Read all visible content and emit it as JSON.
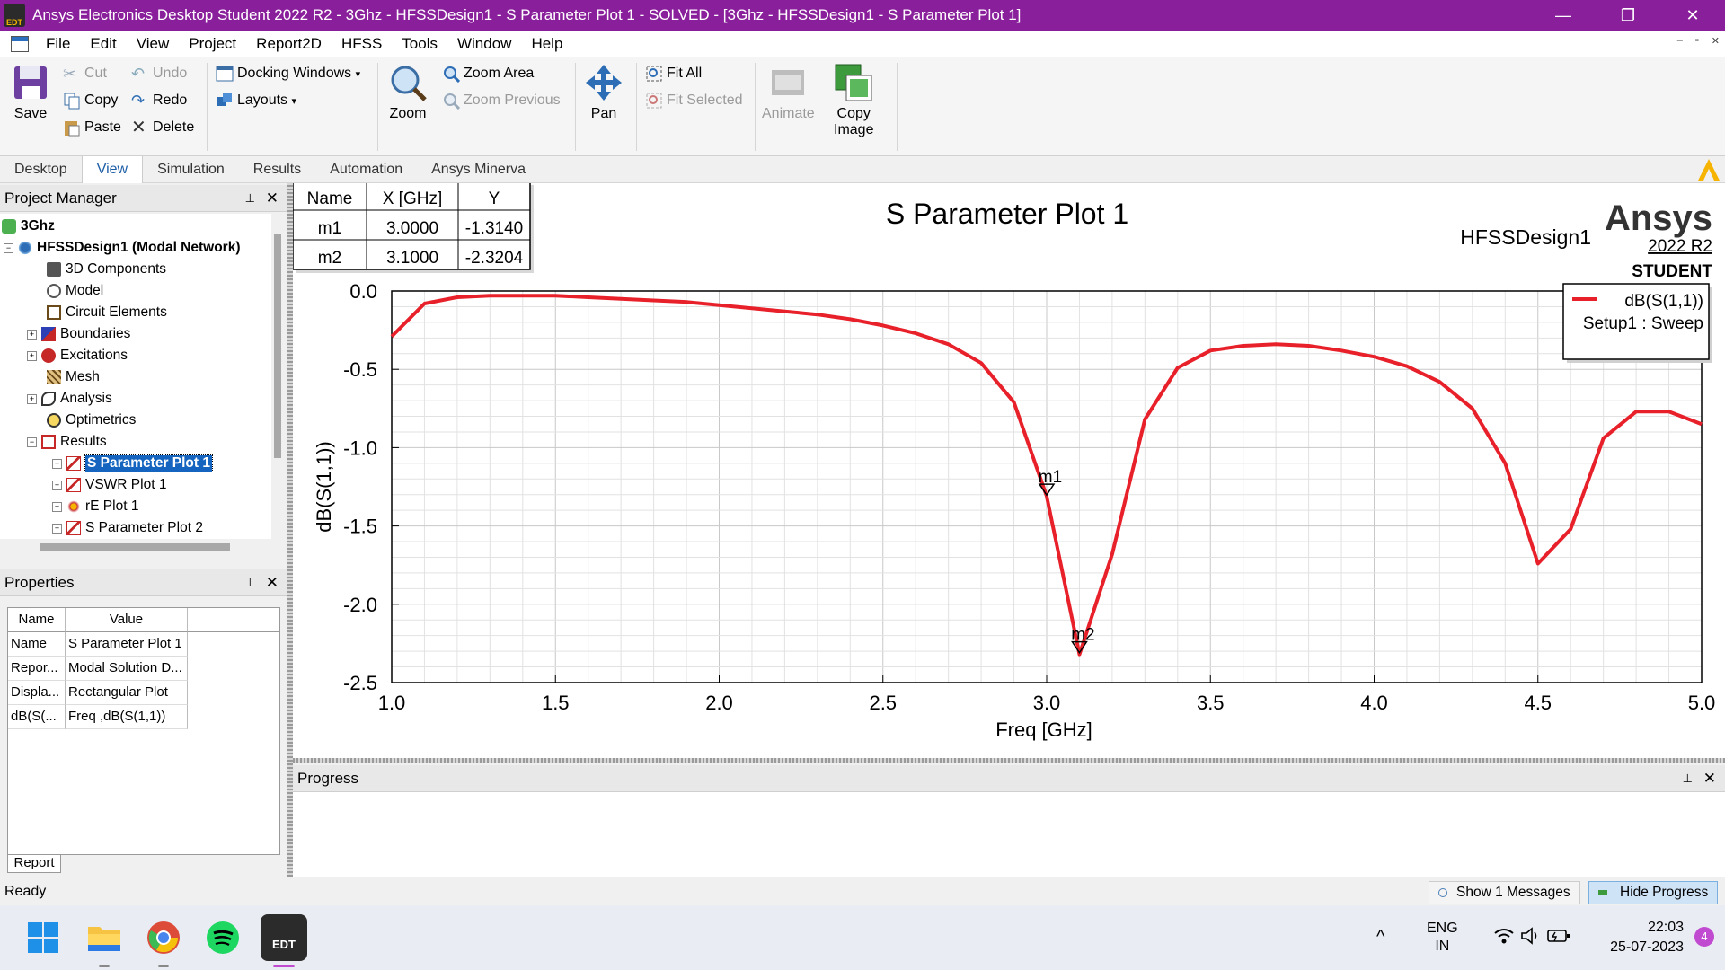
{
  "titlebar": {
    "icon_text": "EDT",
    "title": "Ansys Electronics Desktop Student 2022 R2 - 3Ghz - HFSSDesign1 - S Parameter Plot 1 - SOLVED - [3Ghz - HFSSDesign1 - S Parameter Plot 1]",
    "minimize": "—",
    "restore": "❐",
    "close": "✕"
  },
  "menubar": {
    "items": [
      "File",
      "Edit",
      "View",
      "Project",
      "Report2D",
      "HFSS",
      "Tools",
      "Window",
      "Help"
    ],
    "mdi_min": "–",
    "mdi_restore": "▫",
    "mdi_close": "✕"
  },
  "ribbon": {
    "save": "Save",
    "cut": "Cut",
    "copy": "Copy",
    "paste": "Paste",
    "undo": "Undo",
    "redo": "Redo",
    "delete": "Delete",
    "docking_windows": "Docking Windows",
    "layouts": "Layouts",
    "zoom": "Zoom",
    "zoom_area": "Zoom Area",
    "zoom_previous": "Zoom Previous",
    "pan": "Pan",
    "fit_all": "Fit All",
    "fit_selected": "Fit Selected",
    "animate": "Animate",
    "copy_image_line1": "Copy",
    "copy_image_line2": "Image",
    "dropdown_arrow": "▾"
  },
  "ribbon_tabs": [
    "Desktop",
    "View",
    "Simulation",
    "Results",
    "Automation",
    "Ansys Minerva"
  ],
  "project_manager": {
    "title": "Project Manager",
    "pin": "⊥",
    "close": "✕",
    "tree": [
      {
        "label": "3Ghz",
        "bold": true
      },
      {
        "label": "HFSSDesign1 (Modal Network)",
        "bold": true
      },
      {
        "label": "3D Components"
      },
      {
        "label": "Model"
      },
      {
        "label": "Circuit Elements"
      },
      {
        "label": "Boundaries"
      },
      {
        "label": "Excitations"
      },
      {
        "label": "Mesh"
      },
      {
        "label": "Analysis"
      },
      {
        "label": "Optimetrics"
      },
      {
        "label": "Results"
      },
      {
        "label": "S Parameter Plot 1",
        "selected": true
      },
      {
        "label": "VSWR Plot 1"
      },
      {
        "label": "rE Plot 1"
      },
      {
        "label": "S Parameter Plot 2"
      }
    ]
  },
  "properties": {
    "title": "Properties",
    "pin": "⊥",
    "close": "✕",
    "headers": [
      "Name",
      "Value"
    ],
    "rows": [
      [
        "Name",
        "S Parameter Plot 1"
      ],
      [
        "Repor...",
        "Modal Solution D..."
      ],
      [
        "Displa...",
        "Rectangular Plot"
      ],
      [
        "dB(S(...",
        "Freq ,dB(S(1,1))"
      ]
    ],
    "report_tab": "Report"
  },
  "plot": {
    "title": "S Parameter Plot 1",
    "design_name": "HFSSDesign1",
    "brand": "Ansys",
    "version": "2022 R2",
    "edition": "STUDENT",
    "legend_trace": "dB(S(1,1))",
    "legend_setup": "Setup1 : Sweep",
    "marker_table": {
      "headers": [
        "Name",
        "X [GHz]",
        "Y"
      ],
      "rows": [
        [
          "m1",
          "3.0000",
          "-1.3140"
        ],
        [
          "m2",
          "3.1000",
          "-2.3204"
        ]
      ]
    }
  },
  "chart_data": {
    "type": "line",
    "title": "S Parameter Plot 1",
    "xlabel": "Freq [GHz]",
    "ylabel": "dB(S(1,1))",
    "xlim": [
      1.0,
      5.0
    ],
    "ylim": [
      -2.5,
      0.0
    ],
    "x_ticks": [
      "1.0",
      "1.5",
      "2.0",
      "2.5",
      "3.0",
      "3.5",
      "4.0",
      "4.5",
      "5.0"
    ],
    "y_ticks": [
      "0.0",
      "-0.5",
      "-1.0",
      "-1.5",
      "-2.0",
      "-2.5"
    ],
    "grid": true,
    "legend_position": "top-right",
    "series": [
      {
        "name": "dB(S(1,1))",
        "color": "#e8202a",
        "x": [
          1.0,
          1.1,
          1.2,
          1.3,
          1.4,
          1.5,
          1.6,
          1.7,
          1.8,
          1.9,
          2.0,
          2.1,
          2.2,
          2.3,
          2.4,
          2.5,
          2.6,
          2.7,
          2.8,
          2.9,
          3.0,
          3.1,
          3.2,
          3.3,
          3.4,
          3.5,
          3.6,
          3.7,
          3.8,
          3.9,
          4.0,
          4.1,
          4.2,
          4.3,
          4.4,
          4.5,
          4.6,
          4.7,
          4.8,
          4.9,
          5.0
        ],
        "y": [
          -0.29,
          -0.08,
          -0.04,
          -0.03,
          -0.03,
          -0.03,
          -0.04,
          -0.05,
          -0.06,
          -0.07,
          -0.09,
          -0.11,
          -0.13,
          -0.15,
          -0.18,
          -0.22,
          -0.27,
          -0.34,
          -0.46,
          -0.71,
          -1.31,
          -2.32,
          -1.68,
          -0.82,
          -0.49,
          -0.38,
          -0.35,
          -0.34,
          -0.35,
          -0.38,
          -0.42,
          -0.48,
          -0.58,
          -0.75,
          -1.1,
          -1.74,
          -1.52,
          -0.94,
          -0.77,
          -0.77,
          -0.85
        ]
      }
    ],
    "markers": [
      {
        "name": "m1",
        "x": 3.0,
        "y": -1.314
      },
      {
        "name": "m2",
        "x": 3.1,
        "y": -2.3204
      }
    ]
  },
  "progress": {
    "title": "Progress",
    "pin": "⊥",
    "close": "✕"
  },
  "statusbar": {
    "status": "Ready",
    "show_messages": "Show 1 Messages",
    "hide_progress": "Hide Progress"
  },
  "taskbar": {
    "edt_label": "EDT",
    "lang_line1": "ENG",
    "lang_line2": "IN",
    "time": "22:03",
    "date": "25-07-2023",
    "notifications": "4",
    "chevron": "^"
  }
}
